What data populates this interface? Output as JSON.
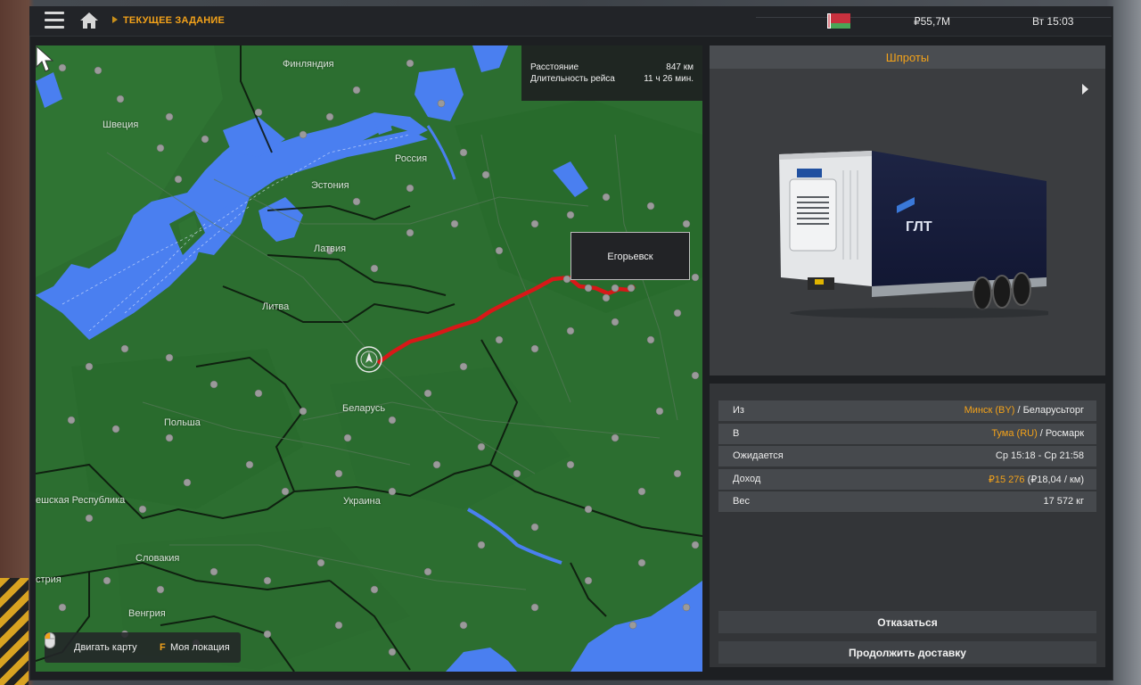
{
  "header": {
    "breadcrumb": "ТЕКУЩЕЕ ЗАДАНИЕ",
    "money": "₽55,7M",
    "time": "Вт 15:03",
    "flag_country": "BY"
  },
  "map": {
    "labels": {
      "finland": "Финляндия",
      "sweden": "Швеция",
      "russia": "Россия",
      "estonia": "Эстония",
      "latvia": "Латвия",
      "lithuania": "Литва",
      "belarus": "Беларусь",
      "poland": "Польша",
      "ukraine": "Украина",
      "czech": "ешская Республика",
      "slovakia": "Словакия",
      "austria": "стрия",
      "hungary": "Венгрия"
    },
    "route_info": {
      "distance_label": "Расстояние",
      "distance_value": "847 км",
      "duration_label": "Длительность рейса",
      "duration_value": "11 ч 26 мин."
    },
    "tooltip_city": "Егорьевск",
    "controls": {
      "move_label": "Двигать карту",
      "location_key": "F",
      "location_label": "Моя локация"
    }
  },
  "cargo": {
    "title": "Шпроты",
    "trailer_brand": "ГЛТ"
  },
  "details": {
    "from_label": "Из",
    "from_city": "Минск (BY)",
    "from_company": " / Беларусьторг",
    "to_label": "В",
    "to_city": "Тума (RU)",
    "to_company": " / Росмарк",
    "expected_label": "Ожидается",
    "expected_value": "Ср 15:18 - Ср 21:58",
    "income_label": "Доход",
    "income_value": "₽15 276",
    "income_rate": " (₽18,04 / км)",
    "weight_label": "Вес",
    "weight_value": "17 572 кг"
  },
  "actions": {
    "decline": "Отказаться",
    "continue": "Продолжить доставку"
  },
  "colors": {
    "accent": "#f3a21a",
    "map_land": "#2c6e30",
    "map_water": "#4a7ff0",
    "route": "#d81818"
  }
}
